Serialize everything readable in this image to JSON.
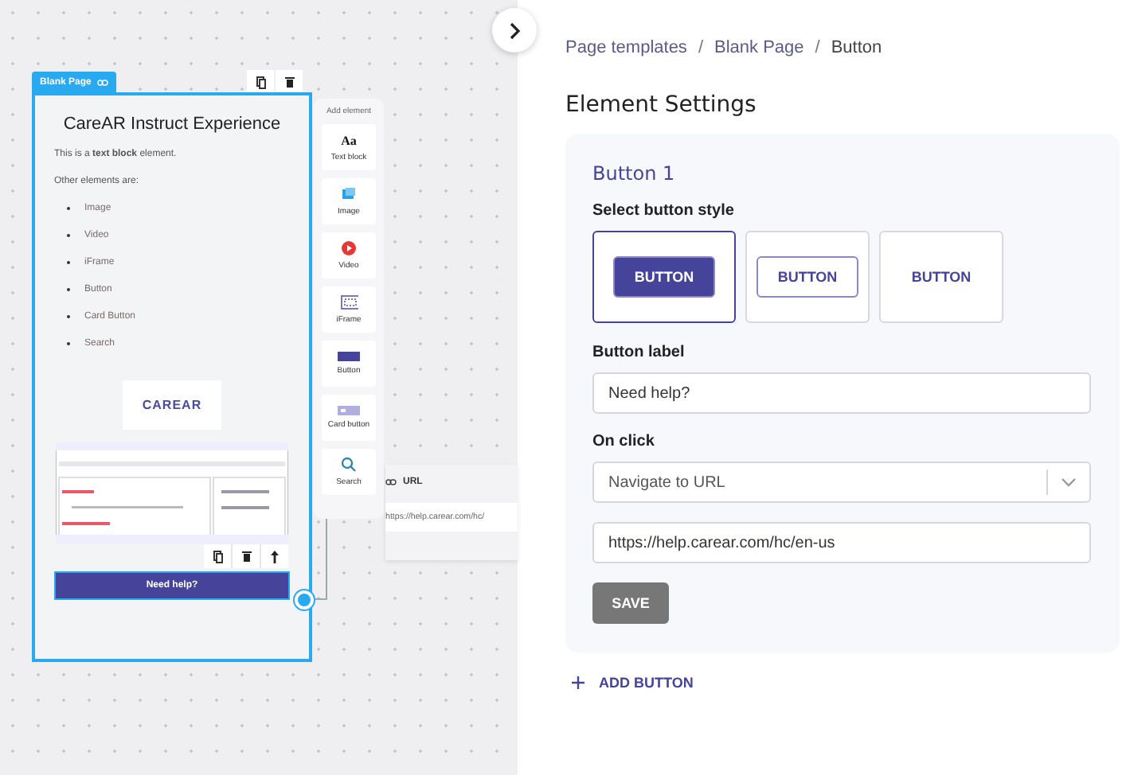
{
  "canvas": {
    "page": {
      "tab": "Blank Page",
      "title": "CareAR Instruct Experience",
      "intro": "This is a **text block** element.",
      "list_heading": "Other elements are:",
      "items": [
        "Image",
        "Video",
        "iFrame",
        "Button",
        "Card Button",
        "Search"
      ],
      "logo": "CAREAR",
      "cta": "Need help?"
    },
    "palette": {
      "title": "Add element",
      "items": [
        {
          "kind": "text",
          "label": "Text block",
          "glyph": "Aa"
        },
        {
          "kind": "image",
          "label": "Image"
        },
        {
          "kind": "video",
          "label": "Video"
        },
        {
          "kind": "iframe",
          "label": "iFrame"
        },
        {
          "kind": "button",
          "label": "Button"
        },
        {
          "kind": "card",
          "label": "Card button"
        },
        {
          "kind": "search",
          "label": "Search"
        }
      ]
    },
    "url_node": {
      "label": "URL",
      "value": "https://help.carear.com/hc/"
    }
  },
  "breadcrumb": [
    "Page templates",
    "Blank Page",
    "Button"
  ],
  "breadcrumb_separator": "/",
  "heading": "Element Settings",
  "button_card": {
    "title": "Button 1",
    "style_label": "Select button style",
    "styles": [
      {
        "kind": "filled",
        "label": "BUTTON",
        "selected": true
      },
      {
        "kind": "outline",
        "label": "BUTTON",
        "selected": false
      },
      {
        "kind": "text",
        "label": "BUTTON",
        "selected": false
      }
    ],
    "label_field": {
      "label": "Button label",
      "value": "Need help?"
    },
    "on_click": {
      "label": "On click",
      "value": "Navigate to URL"
    },
    "url": "https://help.carear.com/hc/en-us",
    "save": {
      "label": "SAVE",
      "disabled": true
    }
  },
  "add_button": "ADD BUTTON"
}
